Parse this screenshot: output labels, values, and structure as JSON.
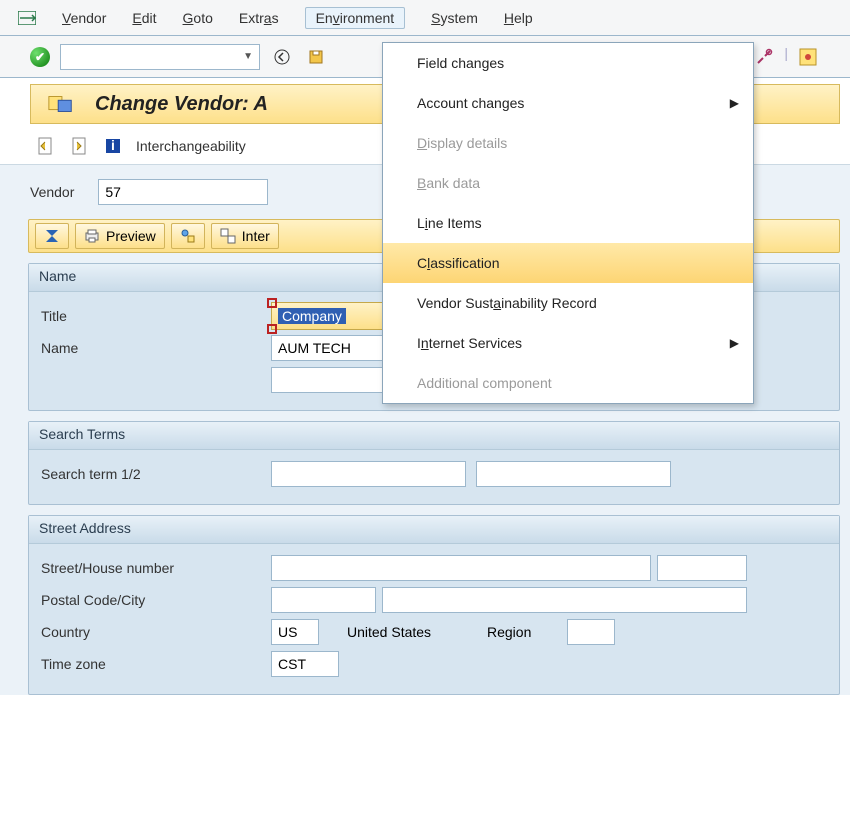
{
  "menu": {
    "vendor": "Vendor",
    "edit": "Edit",
    "goto": "Goto",
    "extras": "Extras",
    "environment": "Environment",
    "system": "System",
    "help": "Help"
  },
  "dropdown": {
    "field_changes": "Field changes",
    "account_changes": "Account changes",
    "display_details": "Display details",
    "bank_data": "Bank data",
    "line_items": "Line Items",
    "classification": "Classification",
    "sustainability": "Vendor Sustainability Record",
    "internet_services": "Internet Services",
    "additional_component": "Additional component"
  },
  "header": {
    "title": "Change Vendor: A",
    "interchangeability": "Interchangeability"
  },
  "vendor": {
    "label": "Vendor",
    "value": "57"
  },
  "button_band": {
    "preview": "Preview",
    "inter": "Inter"
  },
  "name_panel": {
    "header": "Name",
    "title_label": "Title",
    "title_value": "Company",
    "name_label": "Name",
    "name_value": "AUM TECH",
    "name_value2": ""
  },
  "search_panel": {
    "header": "Search Terms",
    "term_label": "Search term 1/2",
    "term1_value": "",
    "term2_value": ""
  },
  "address_panel": {
    "header": "Street Address",
    "street_label": "Street/House number",
    "street_value": "",
    "house_value": "",
    "postal_label": "Postal Code/City",
    "postal_value": "",
    "city_value": "",
    "country_label": "Country",
    "country_value": "US",
    "country_name": "United States",
    "region_label": "Region",
    "region_value": "",
    "tz_label": "Time zone",
    "tz_value": "CST"
  }
}
